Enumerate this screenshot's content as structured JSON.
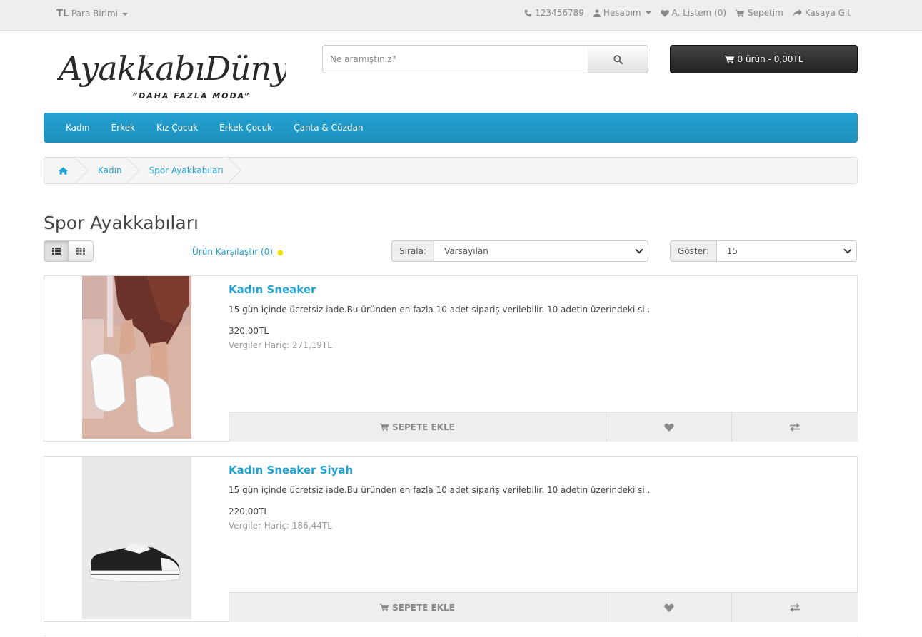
{
  "topbar": {
    "currency_symbol": "TL",
    "currency_label": "Para Birimi",
    "phone": "123456789",
    "account": "Hesabım",
    "wishlist": "A. Listem (0)",
    "cart": "Sepetim",
    "checkout": "Kasaya Git"
  },
  "header": {
    "logo_text": "AyakkabıDünyası",
    "logo_tagline": "“DAHA FAZLA MODA”",
    "search_placeholder": "Ne aramıştınız?",
    "cart_summary": "0 ürün - 0,00TL"
  },
  "nav": {
    "items": [
      "Kadın",
      "Erkek",
      "Kız Çocuk",
      "Erkek Çocuk",
      "Çanta & Cüzdan"
    ]
  },
  "breadcrumb": {
    "items": [
      "Kadın",
      "Spor Ayakkabıları"
    ]
  },
  "page": {
    "title": "Spor Ayakkabıları",
    "compare": "Ürün Karşılaştır (0)",
    "sort_label": "Sırala:",
    "sort_value": "Varsayılan",
    "limit_label": "Göster:",
    "limit_value": "15"
  },
  "products": [
    {
      "name": "Kadın Sneaker",
      "description": "15 gün içinde ücretsiz iade.Bu üründen en fazla 10 adet sipariş verilebilir. 10 adetin üzerindeki si..",
      "price": "320,00TL",
      "tax": "Vergiler Hariç: 271,19TL",
      "cart_label": "SEPETE EKLE"
    },
    {
      "name": "Kadın Sneaker Siyah",
      "description": "15 gün içinde ücretsiz iade.Bu üründen en fazla 10 adet sipariş verilebilir. 10 adetin üzerindeki si..",
      "price": "220,00TL",
      "tax": "Vergiler Hariç: 186,44TL",
      "cart_label": "SEPETE EKLE"
    }
  ],
  "colors": {
    "accent": "#23a1d1",
    "topbar_bg": "#eeeeee",
    "cart_button": "#333333"
  }
}
